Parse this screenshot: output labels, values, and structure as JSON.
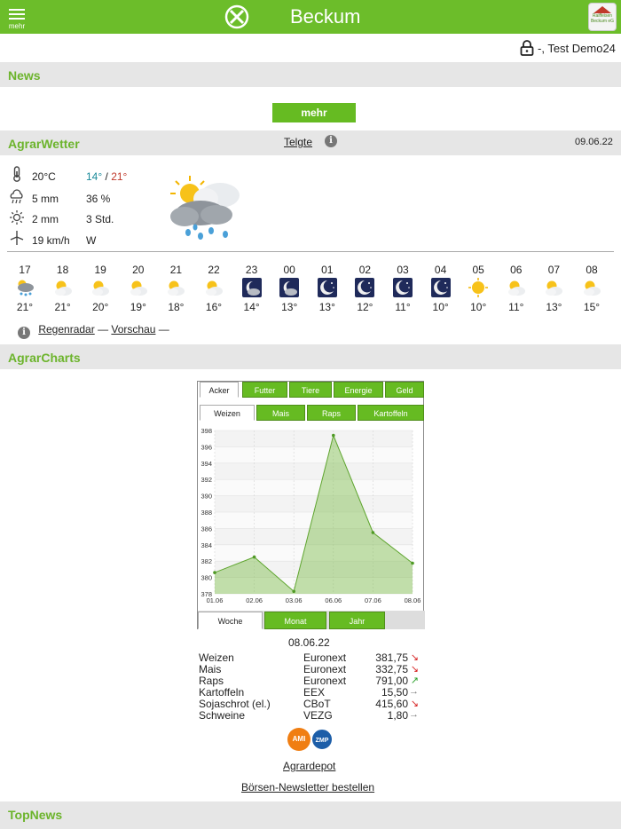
{
  "header": {
    "menu_label": "mehr",
    "title": "Beckum",
    "brand_text": "Raiffeisen Beckum eG"
  },
  "user": {
    "name": "-, Test Demo24"
  },
  "news": {
    "title": "News",
    "more_button": "mehr"
  },
  "weather": {
    "title": "AgrarWetter",
    "location": "Telgte",
    "date": "09.06.22",
    "temp_now": "20°C",
    "temp_min": "14°",
    "separator": "/",
    "temp_max": "21°",
    "rain": "5 mm",
    "rain_prob": "36 %",
    "sun": "2 mm",
    "sun_hours": "3 Std.",
    "wind": "19 km/h",
    "wind_dir": "W",
    "colors": {
      "min": "#1a8a9a",
      "max": "#c0392b"
    },
    "hourly": [
      {
        "h": "17",
        "t": "21°",
        "icon": "cloud-rain"
      },
      {
        "h": "18",
        "t": "21°",
        "icon": "sun-cloud"
      },
      {
        "h": "19",
        "t": "20°",
        "icon": "sun-cloud"
      },
      {
        "h": "20",
        "t": "19°",
        "icon": "sun-cloud"
      },
      {
        "h": "21",
        "t": "18°",
        "icon": "sun-cloud"
      },
      {
        "h": "22",
        "t": "16°",
        "icon": "sun-cloud"
      },
      {
        "h": "23",
        "t": "14°",
        "icon": "moon-cloud"
      },
      {
        "h": "00",
        "t": "13°",
        "icon": "moon-cloud"
      },
      {
        "h": "01",
        "t": "13°",
        "icon": "moon-stars"
      },
      {
        "h": "02",
        "t": "12°",
        "icon": "moon-stars"
      },
      {
        "h": "03",
        "t": "11°",
        "icon": "moon-stars"
      },
      {
        "h": "04",
        "t": "10°",
        "icon": "moon-stars"
      },
      {
        "h": "05",
        "t": "10°",
        "icon": "sun"
      },
      {
        "h": "06",
        "t": "11°",
        "icon": "sun-cloud"
      },
      {
        "h": "07",
        "t": "13°",
        "icon": "sun-cloud"
      },
      {
        "h": "08",
        "t": "15°",
        "icon": "sun-cloud"
      }
    ],
    "radar_link": "Regenradar",
    "dash": "—",
    "forecast_link": "Vorschau"
  },
  "charts": {
    "title": "AgrarCharts",
    "tabs": [
      "Acker",
      "Futter",
      "Tiere",
      "Energie",
      "Geld"
    ],
    "subtabs": [
      "Weizen",
      "Mais",
      "Raps",
      "Kartoffeln"
    ],
    "period_tabs": [
      "Woche",
      "Monat",
      "Jahr"
    ]
  },
  "chart_data": {
    "type": "area",
    "x": [
      "01.06",
      "02.06",
      "03.06",
      "06.06",
      "07.06",
      "08.06"
    ],
    "values": [
      380.6,
      382.5,
      378.3,
      397.4,
      385.5,
      381.75
    ],
    "ylim": [
      378,
      398
    ],
    "yticks": [
      378,
      380,
      382,
      384,
      386,
      388,
      390,
      392,
      394,
      396,
      398
    ],
    "grid": true,
    "color": "#7cbd4a"
  },
  "markets": {
    "date": "08.06.22",
    "rows": [
      {
        "name": "Weizen",
        "exchange": "Euronext",
        "value": "381,75",
        "arrow": "↘",
        "trend": "down"
      },
      {
        "name": "Mais",
        "exchange": "Euronext",
        "value": "332,75",
        "arrow": "↘",
        "trend": "down"
      },
      {
        "name": "Raps",
        "exchange": "Euronext",
        "value": "791,00",
        "arrow": "↗",
        "trend": "up"
      },
      {
        "name": "Kartoffeln",
        "exchange": "EEX",
        "value": "15,50",
        "arrow": "→",
        "trend": "flat"
      },
      {
        "name": "Sojaschrot (el.)",
        "exchange": "CBoT",
        "value": "415,60",
        "arrow": "↘",
        "trend": "down"
      },
      {
        "name": "Schweine",
        "exchange": "VEZG",
        "value": "1,80",
        "arrow": "→",
        "trend": "flat"
      }
    ],
    "provider1": "AMI",
    "provider2": "ZMP",
    "agrardepot": "Agrardepot",
    "newsletter": "Börsen-Newsletter bestellen"
  },
  "topnews": {
    "title": "TopNews"
  }
}
